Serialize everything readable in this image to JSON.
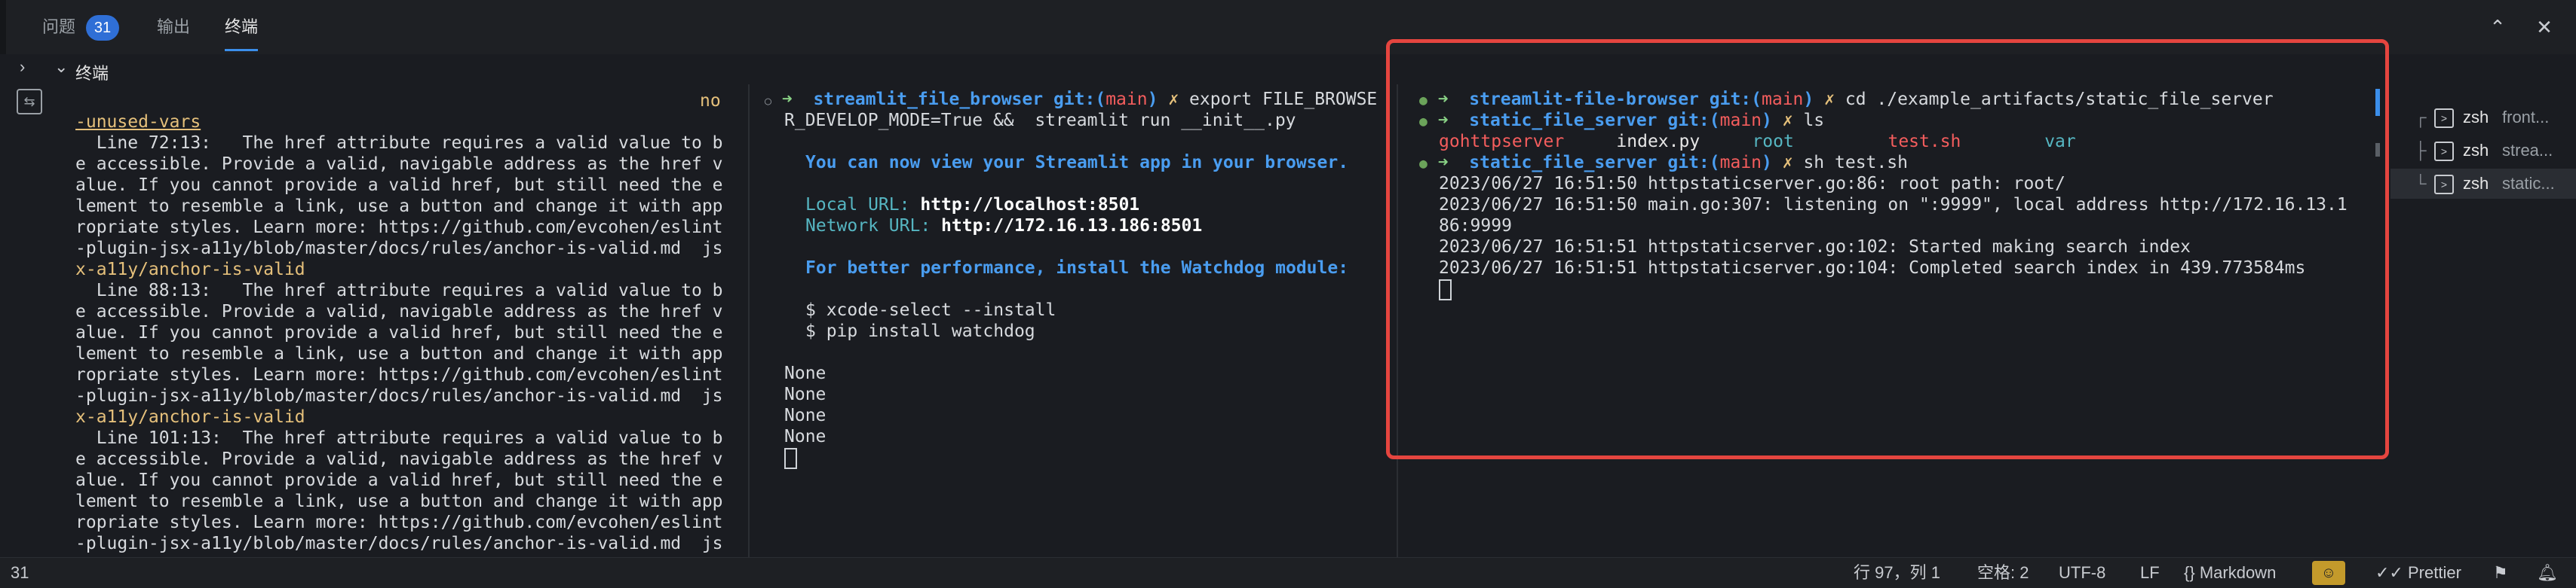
{
  "tabs": [
    {
      "label": "问题",
      "badge": "31"
    },
    {
      "label": "输出"
    },
    {
      "label": "终端"
    }
  ],
  "toolbar_icons": [
    "chevron-up-icon",
    "close-icon"
  ],
  "section_title": "终端",
  "pane1": {
    "lines": [
      {
        "t": "no",
        "cls": "yellow",
        "indent": 42,
        "right": true
      },
      {
        "t": "-unused-vars",
        "cls": "yellow und"
      },
      {
        "t": "  Line 72:13:   The href attribute requires a valid value to b"
      },
      {
        "t": "e accessible. Provide a valid, navigable address as the href v"
      },
      {
        "t": "alue. If you cannot provide a valid href, but still need the e"
      },
      {
        "t": "lement to resemble a link, use a button and change it with app"
      },
      {
        "t": "ropriate styles. Learn more: https://github.com/evcohen/eslint"
      },
      {
        "t": "-plugin-jsx-a11y/blob/master/docs/rules/anchor-is-valid.md  js"
      },
      {
        "t": "x-a11y/anchor-is-valid",
        "cls": "yellow"
      },
      {
        "t": "  Line 88:13:   The href attribute requires a valid value to b"
      },
      {
        "t": "e accessible. Provide a valid, navigable address as the href v"
      },
      {
        "t": "alue. If you cannot provide a valid href, but still need the e"
      },
      {
        "t": "lement to resemble a link, use a button and change it with app"
      },
      {
        "t": "ropriate styles. Learn more: https://github.com/evcohen/eslint"
      },
      {
        "t": "-plugin-jsx-a11y/blob/master/docs/rules/anchor-is-valid.md  js"
      },
      {
        "t": "x-a11y/anchor-is-valid",
        "cls": "yellow"
      },
      {
        "t": "  Line 101:13:  The href attribute requires a valid value to b"
      },
      {
        "t": "e accessible. Provide a valid, navigable address as the href v"
      },
      {
        "t": "alue. If you cannot provide a valid href, but still need the e"
      },
      {
        "t": "lement to resemble a link, use a button and change it with app"
      },
      {
        "t": "ropriate styles. Learn more: https://github.com/evcohen/eslint"
      },
      {
        "t": "-plugin-jsx-a11y/blob/master/docs/rules/anchor-is-valid.md  js"
      }
    ]
  },
  "pane2": {
    "prompt_dir": "streamlit_file_browser",
    "prompt_git": "git:(",
    "prompt_branch": "main",
    "prompt_git_close": ")",
    "prompt_x": "✗",
    "cmd1": "export FILE_BROWSE",
    "cmd1_cont": "R_DEVELOP_MODE=True &&  streamlit run __init__.py",
    "view_msg": "You can now view your Streamlit app in your browser.",
    "local_label": "Local URL:",
    "local_url": "http://localhost:8501",
    "network_label": "Network URL:",
    "network_url": "http://172.16.13.186:8501",
    "perf_msg": "For better performance, install the Watchdog module:",
    "cmd_xcode": "$ xcode-select --install",
    "cmd_pip": "$ pip install watchdog",
    "none_lines": [
      "None",
      "None",
      "None",
      "None"
    ]
  },
  "pane3": {
    "line1_dir": "streamlit-file-browser",
    "line1_cmd": "cd ./example_artifacts/static_file_server",
    "line2_dir": "static_file_server",
    "line2_cmd": "ls",
    "ls_items": [
      {
        "name": "gohttpserver",
        "color": "red"
      },
      {
        "name": "index.py",
        "color": "white"
      },
      {
        "name": "root",
        "color": "cyan"
      },
      {
        "name": "test.sh",
        "color": "red"
      },
      {
        "name": "var",
        "color": "cyan"
      }
    ],
    "line3_dir": "static_file_server",
    "line3_cmd": "sh test.sh",
    "log": [
      "2023/06/27 16:51:50 httpstaticserver.go:86: root path: root/",
      "2023/06/27 16:51:50 main.go:307: listening on \":9999\", local address http://172.16.13.1",
      "86:9999",
      "2023/06/27 16:51:51 httpstaticserver.go:102: Started making search index",
      "2023/06/27 16:51:51 httpstaticserver.go:104: Completed search index in 439.773584ms"
    ],
    "git": "git:(",
    "branch": "main",
    "git_close": ")",
    "x": "✗"
  },
  "terminals": [
    {
      "name": "zsh",
      "sub": "front..."
    },
    {
      "name": "zsh",
      "sub": "strea..."
    },
    {
      "name": "zsh",
      "sub": "static..."
    }
  ],
  "status": {
    "left_count": "31",
    "cursor_pos": "行 97，列 1",
    "spaces": "空格: 2",
    "encoding": "UTF-8",
    "eol": "LF",
    "language": "Markdown",
    "prettier": "Prettier"
  },
  "colors": {
    "accent": "#3b8eea",
    "highlight_box": "#e5453f",
    "badge": "#2f6fd6"
  }
}
